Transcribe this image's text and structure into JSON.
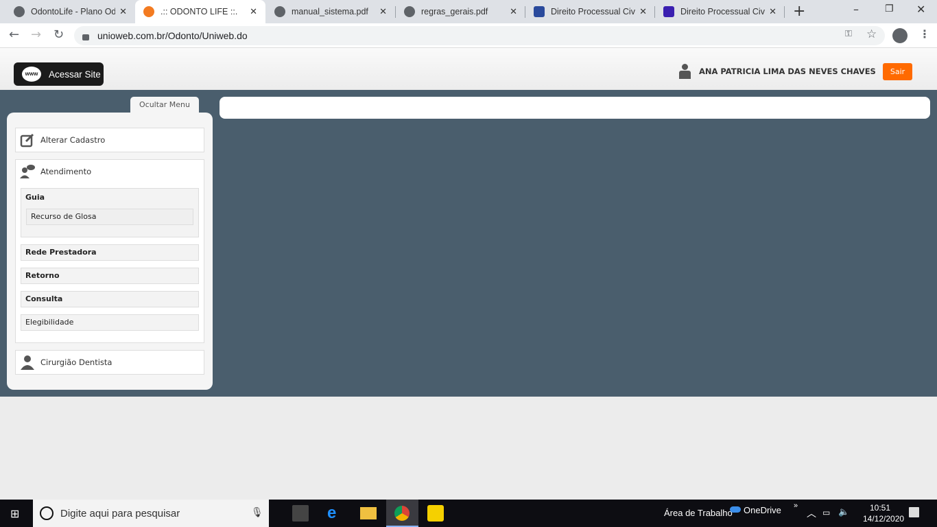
{
  "browser": {
    "tabs": [
      {
        "title": "OdontoLife - Plano Odo",
        "active": false
      },
      {
        "title": ".:: ODONTO LIFE ::.",
        "active": true
      },
      {
        "title": "manual_sistema.pdf",
        "active": false
      },
      {
        "title": "regras_gerais.pdf",
        "active": false
      },
      {
        "title": "Direito Processual Civil",
        "active": false
      },
      {
        "title": "Direito Processual Civil",
        "active": false
      }
    ],
    "url": "unioweb.com.br/Odonto/Uniweb.do"
  },
  "header": {
    "site_button": "Acessar Site",
    "www_icon": "www",
    "user_name": "ANA PATRICIA LIMA DAS NEVES CHAVES",
    "logout": "Sair"
  },
  "sidebar": {
    "toggle": "Ocultar Menu",
    "alterar": "Alterar Cadastro",
    "atendimento": "Atendimento",
    "guia": "Guia",
    "recurso": "Recurso de Glosa",
    "rede": "Rede Prestadora",
    "retorno": "Retorno",
    "consulta": "Consulta",
    "elegibilidade": "Elegibilidade",
    "cirurgiao": "Cirurgião Dentista"
  },
  "taskbar": {
    "search_placeholder": "Digite aqui para pesquisar",
    "desktop": "Área de Trabalho",
    "onedrive": "OneDrive",
    "time": "10:51",
    "date": "14/12/2020"
  },
  "colors": {
    "accent": "#ff6a00",
    "main_bg": "#4a5e6d"
  }
}
